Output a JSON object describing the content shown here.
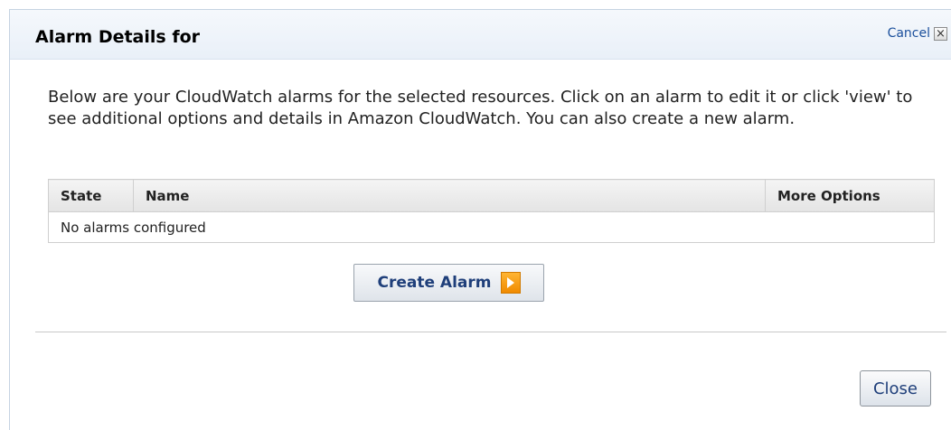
{
  "dialog": {
    "title": "Alarm Details for",
    "cancel_label": "Cancel",
    "close_icon_glyph": "×"
  },
  "intro_text": "Below are your CloudWatch alarms for the selected resources. Click on an alarm to edit it or click 'view' to see additional options and details in Amazon CloudWatch. You can also create a new alarm.",
  "table": {
    "headers": {
      "state": "State",
      "name": "Name",
      "more_options": "More Options"
    },
    "empty_message": "No alarms configured"
  },
  "actions": {
    "create_alarm_label": "Create Alarm",
    "create_alarm_icon": "play-arrow-icon",
    "close_label": "Close"
  },
  "colors": {
    "link": "#1a4f9c",
    "button_text": "#1f3f7a",
    "accent_orange": "#f08a00"
  }
}
